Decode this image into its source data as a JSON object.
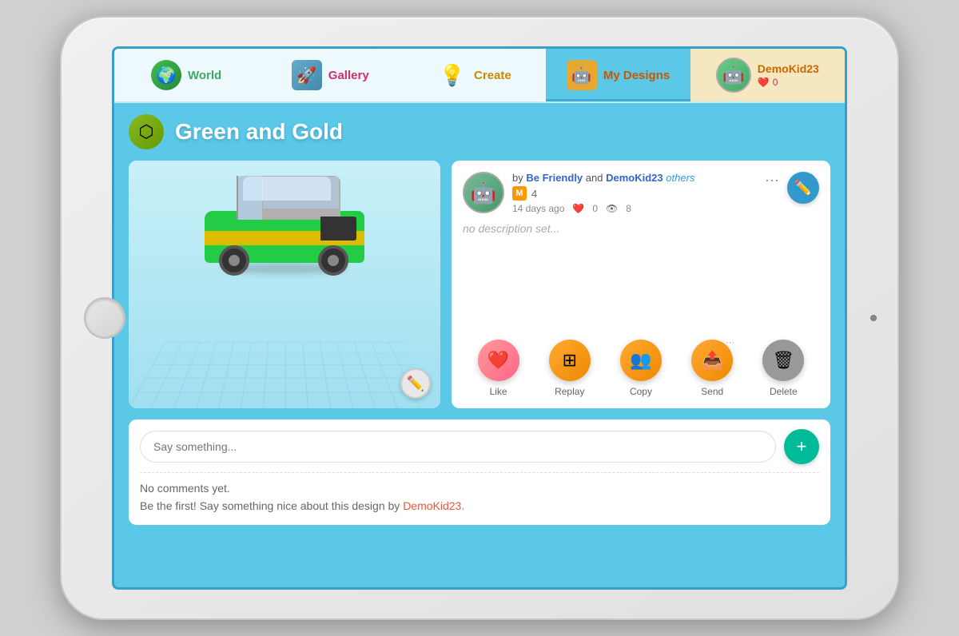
{
  "nav": {
    "world_label": "World",
    "gallery_label": "Gallery",
    "create_label": "Create",
    "mydesigns_label": "My Designs",
    "user_label": "DemoKid23",
    "user_hearts": "0"
  },
  "page": {
    "title": "Green and Gold",
    "description": "no description set...",
    "created_by_prefix": "by",
    "author1": "Be Friendly",
    "author_and": "and",
    "author2": "DemoKid23",
    "others_label": "others",
    "badge_num": "4",
    "time_ago": "14 days ago",
    "likes_count": "0",
    "views_count": "8"
  },
  "actions": {
    "like_label": "Like",
    "replay_label": "Replay",
    "copy_label": "Copy",
    "send_label": "Send",
    "delete_label": "Delete"
  },
  "comments": {
    "placeholder": "Say something...",
    "no_comments_line1": "No comments yet.",
    "no_comments_line2": "Be the first! Say something nice about this design by",
    "no_comments_author": "DemoKid23.",
    "submit_icon": "+"
  }
}
